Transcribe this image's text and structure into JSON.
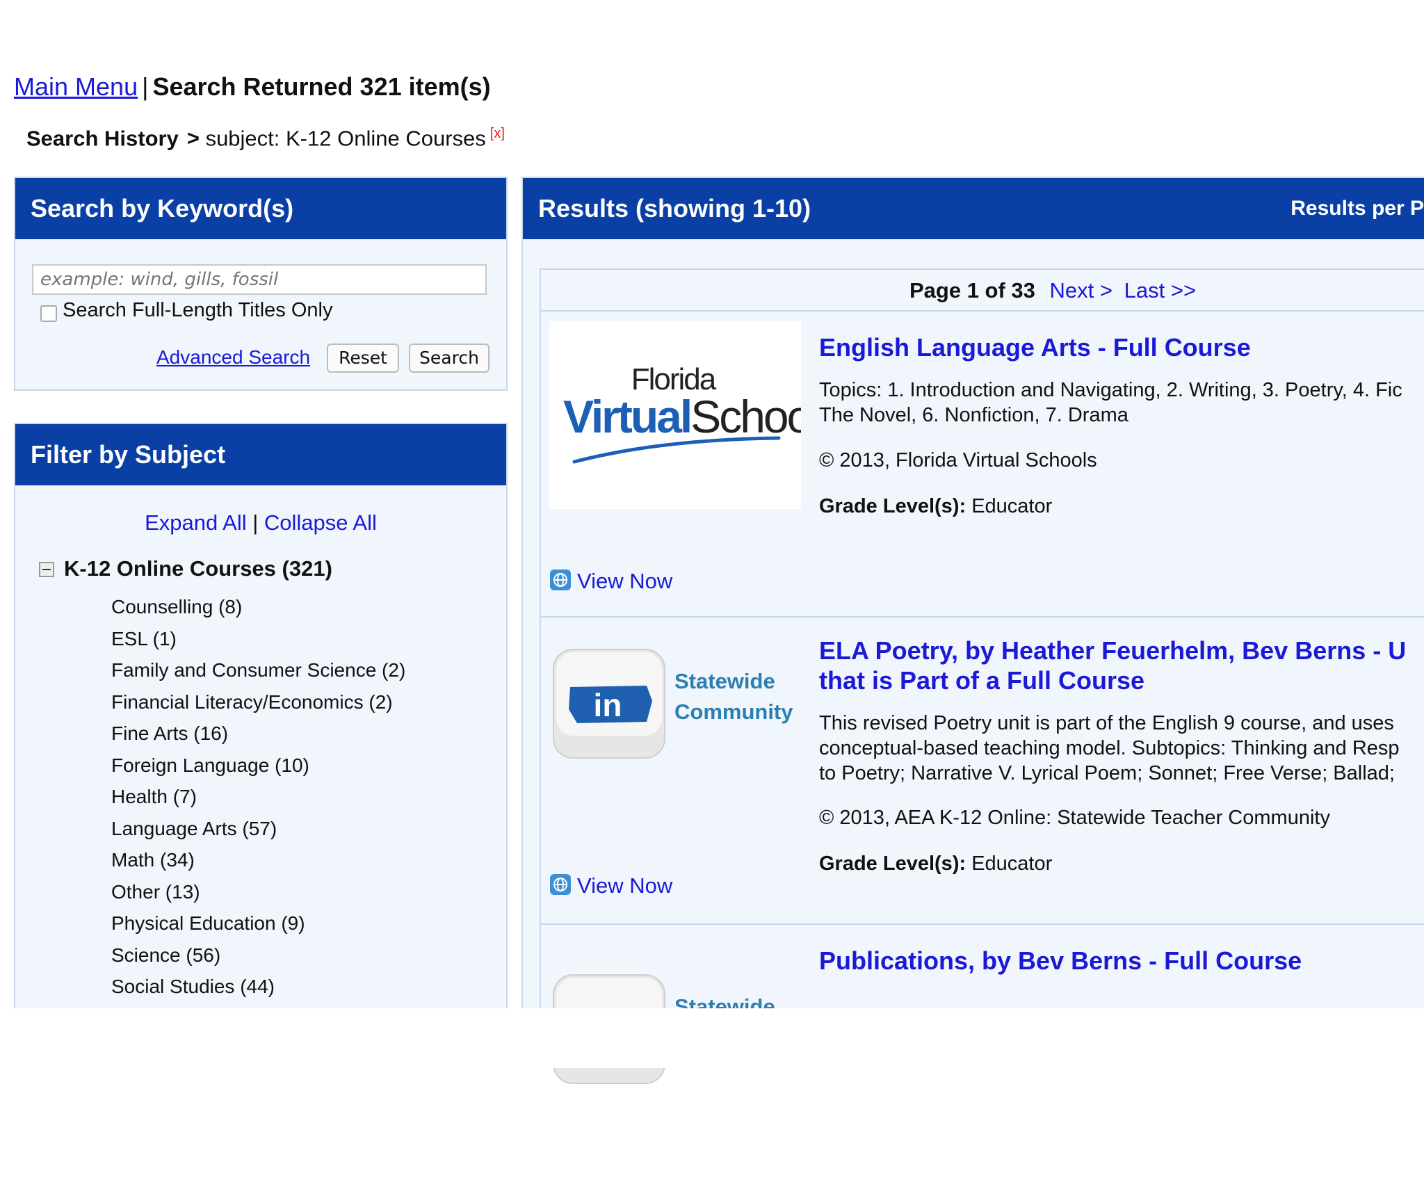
{
  "header": {
    "main_menu": "Main Menu",
    "separator": "|",
    "returned": "Search Returned 321 item(s)"
  },
  "history": {
    "label": "Search History",
    "arrow": ">",
    "query": "subject: K-12 Online Courses",
    "remove": "[x]"
  },
  "keyword_panel": {
    "title": "Search by Keyword(s)",
    "placeholder": "example: wind, gills, fossil",
    "checkbox_label": "Search Full-Length Titles Only",
    "advanced": "Advanced Search",
    "reset": "Reset",
    "search": "Search"
  },
  "subject_panel": {
    "title": "Filter by Subject",
    "expand_all": "Expand All",
    "divider": "|",
    "collapse_all": "Collapse All",
    "root": "K-12 Online Courses (321)",
    "items": [
      "Counselling (8)",
      "ESL (1)",
      "Family and Consumer Science (2)",
      "Financial Literacy/Economics (2)",
      "Fine Arts (16)",
      "Foreign Language (10)",
      "Health (7)",
      "Language Arts (57)",
      "Math (34)",
      "Other (13)",
      "Physical Education (9)",
      "Science (56)",
      "Social Studies (44)"
    ]
  },
  "results": {
    "title": "Results (showing 1-10)",
    "per_page": "Results per P",
    "pager": {
      "page": "Page 1 of 33",
      "next": "Next >",
      "last": "Last >>"
    },
    "items": [
      {
        "logo_top": "Florida",
        "logo_bold": "Virtual",
        "logo_rest": "School",
        "title": "English Language Arts - Full Course",
        "desc1": "Topics: 1. Introduction and Navigating, 2. Writing, 3. Poetry, 4. Fic",
        "desc2": "The Novel, 6. Nonfiction, 7. Drama",
        "copyright": "© 2013, Florida Virtual Schools",
        "grade_label": "Grade Level(s):",
        "grade_value": "Educator",
        "view": "View Now"
      },
      {
        "logo_line1": "Statewide",
        "logo_line2": "Community",
        "logo_mark": "in",
        "title1": "ELA Poetry, by Heather Feuerhelm, Bev Berns - U",
        "title2": "that is Part of a Full Course",
        "desc1": "This revised Poetry unit is part of the English 9 course, and uses",
        "desc2": "conceptual-based teaching model. Subtopics: Thinking and Resp",
        "desc3": "to Poetry; Narrative V. Lyrical Poem; Sonnet; Free Verse; Ballad;",
        "copyright": "© 2013, AEA K-12 Online: Statewide Teacher Community",
        "grade_label": "Grade Level(s):",
        "grade_value": "Educator",
        "view": "View Now"
      },
      {
        "logo_line1": "Statewide",
        "title": "Publications, by Bev Berns - Full Course"
      }
    ]
  },
  "colors": {
    "header_blue": "#0a3fa6",
    "link_blue": "#1a1ad6",
    "panel_bg": "#f1f5fc",
    "statewide_teal": "#2c7fb0",
    "remove_red": "#e02020"
  },
  "icons": [
    "collapse-minus-icon",
    "globe-icon",
    "florida-virtual-school-logo",
    "statewide-community-logo"
  ]
}
